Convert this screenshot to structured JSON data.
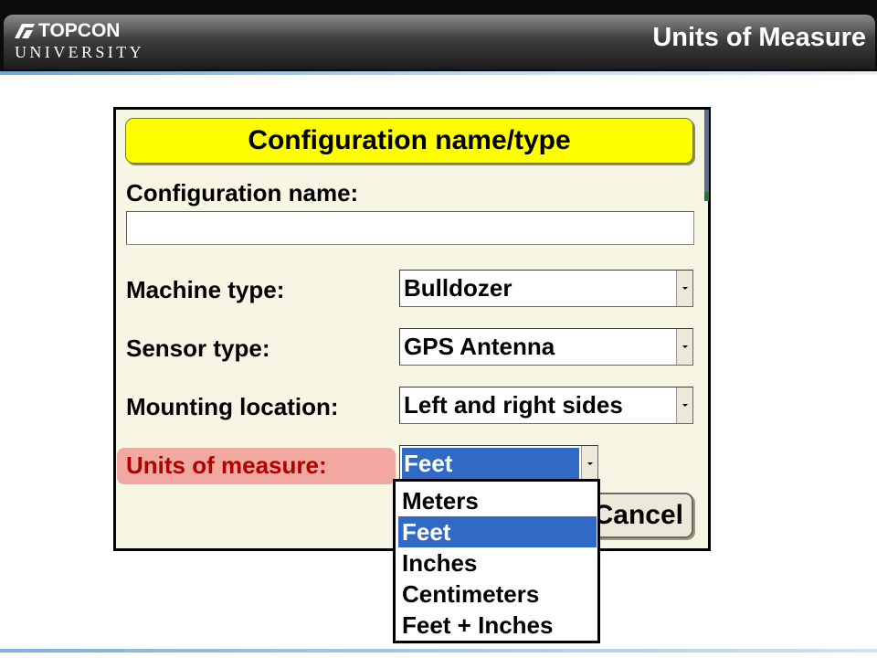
{
  "header": {
    "logo_brand": "TOPCON",
    "logo_sub": "UNIVERSITY",
    "slide_title": "Units of Measure"
  },
  "dialog": {
    "title": "Configuration name/type",
    "config_name_label": "Configuration name:",
    "config_name_value": "",
    "machine_type_label": "Machine type:",
    "machine_type_value": "Bulldozer",
    "sensor_type_label": "Sensor type:",
    "sensor_type_value": "GPS Antenna",
    "mounting_location_label": "Mounting location:",
    "mounting_location_value": "Left and right sides",
    "units_label": "Units of measure:",
    "units_value": "Feet",
    "cancel_label": "Cancel",
    "units_options": [
      {
        "label": "Meters",
        "selected": false
      },
      {
        "label": "Feet",
        "selected": true
      },
      {
        "label": "Inches",
        "selected": false
      },
      {
        "label": "Centimeters",
        "selected": false
      },
      {
        "label": "Feet + Inches",
        "selected": false
      }
    ]
  },
  "colors": {
    "title_bar": "#ffff00",
    "highlight": "#f0a8a0",
    "selection": "#316ac5",
    "window_bg": "#f7f5e4"
  }
}
